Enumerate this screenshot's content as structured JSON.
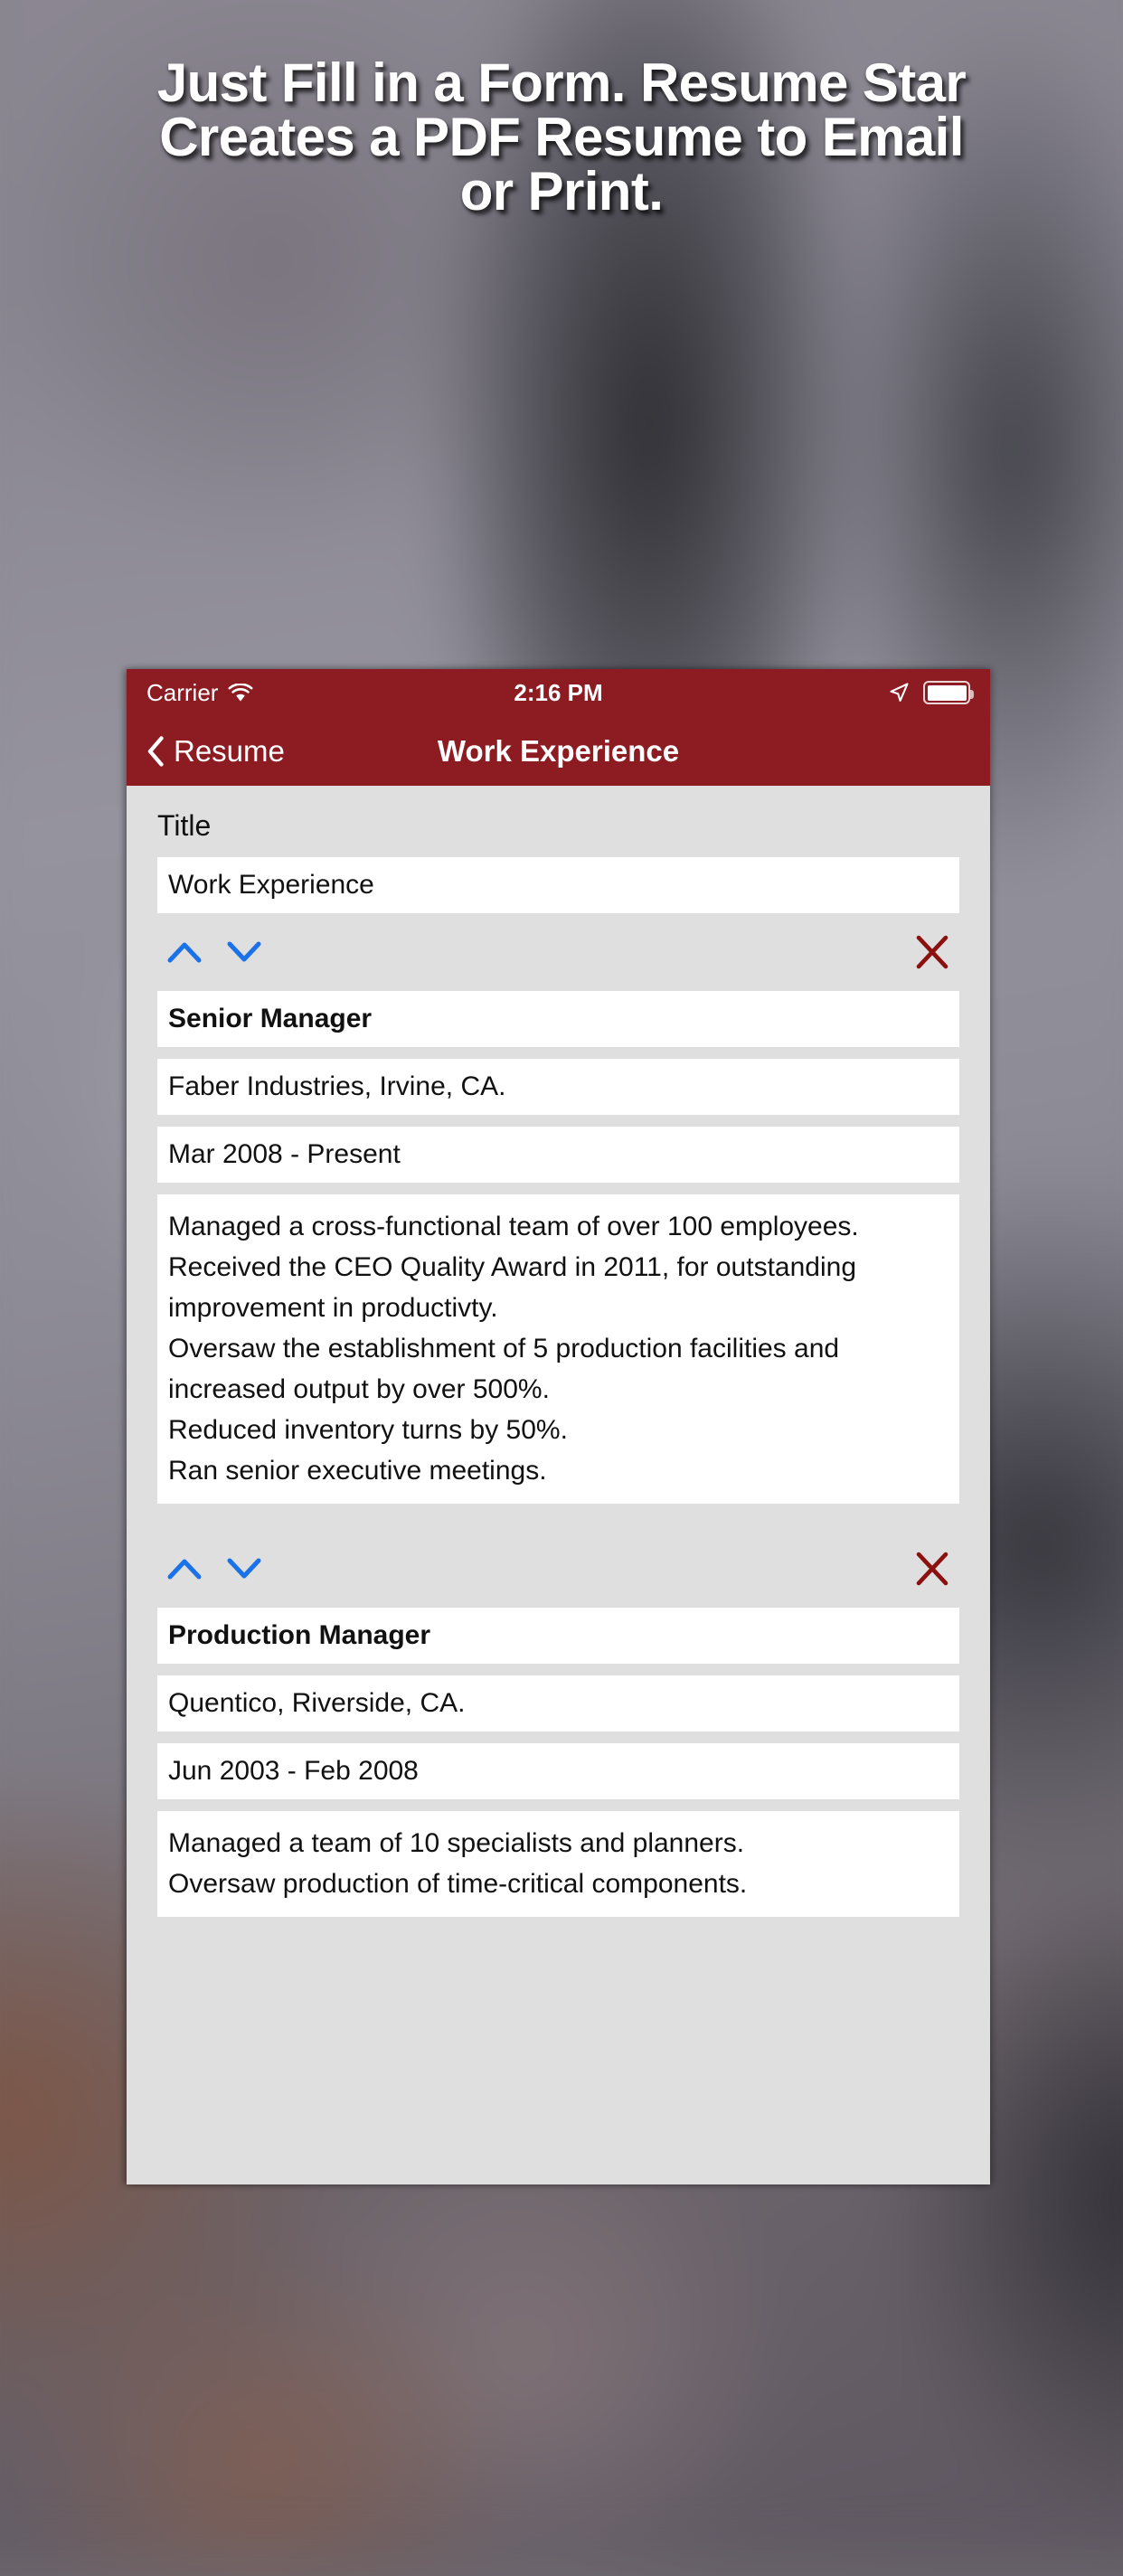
{
  "promo": {
    "headline": "Just Fill in a Form. Resume Star\nCreates a PDF Resume to Email\nor Print."
  },
  "theme": {
    "brand_red": "#8c1b22",
    "screen_bg": "#dfdfdf",
    "field_bg": "#ffffff",
    "arrow_blue": "#1b72e8",
    "delete_red": "#8b1010",
    "headline_color": "#ffffff"
  },
  "status_bar": {
    "carrier": "Carrier",
    "wifi_icon": "wifi-icon",
    "time": "2:16 PM",
    "location_icon": "location-arrow-icon",
    "battery_icon": "battery-full-icon"
  },
  "nav_bar": {
    "back_icon": "chevron-left-icon",
    "back_label": "Resume",
    "title": "Work Experience"
  },
  "form": {
    "title_label": "Title",
    "title_value": "Work Experience",
    "controls": {
      "move_up_icon": "chevron-up-icon",
      "move_down_icon": "chevron-down-icon",
      "delete_icon": "close-x-icon"
    },
    "entries": [
      {
        "position": "Senior Manager",
        "company": "Faber Industries, Irvine, CA.",
        "dates": "Mar 2008 - Present",
        "description": "Managed a cross-functional team of over 100 employees.\nReceived the CEO Quality Award in 2011, for outstanding improvement in productivty.\nOversaw the establishment of 5 production facilities and increased output by over 500%.\nReduced inventory turns by 50%.\nRan senior executive meetings."
      },
      {
        "position": "Production Manager",
        "company": "Quentico, Riverside, CA.",
        "dates": "Jun 2003 - Feb 2008",
        "description": "Managed a team of 10 specialists and planners.\nOversaw production of time-critical components."
      }
    ]
  }
}
